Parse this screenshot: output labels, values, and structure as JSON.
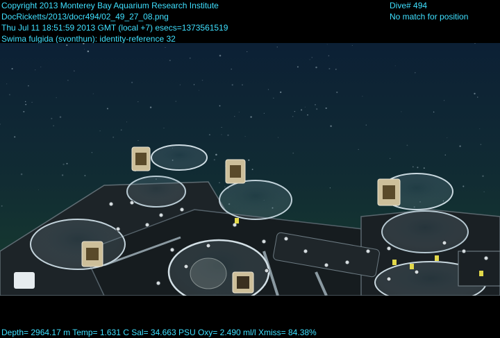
{
  "overlay": {
    "header_left": [
      "Copyright 2013 Monterey Bay Aquarium Research Institute",
      "DocRicketts/2013/docr494/02_49_27_08.png",
      "Thu Jul 11 18:51:59 2013 GMT (local +7)  esecs=1373561519",
      "Swima fulgida (svonthun): identity-reference 32"
    ],
    "header_right": [
      "Dive# 494",
      "No match for position"
    ],
    "footer": "Depth= 2964.17 m  Temp= 1.631 C  Sal= 34.663 PSU  Oxy= 2.490 ml/l  Xmiss= 84.38%"
  },
  "colors": {
    "overlay_text": "#3fe0ff",
    "water_top": "#0e2338",
    "water_bottom": "#143a2c"
  }
}
